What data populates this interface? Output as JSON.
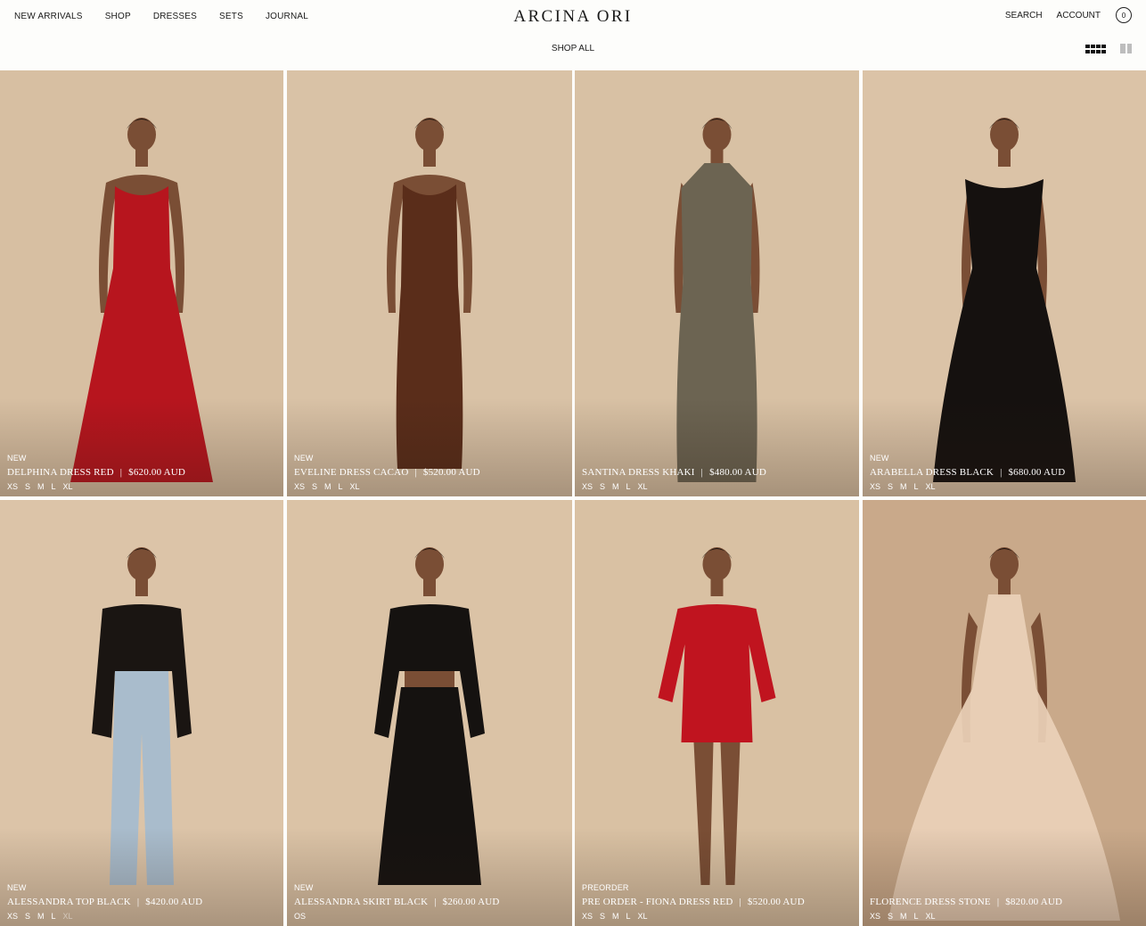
{
  "header": {
    "nav": [
      "NEW ARRIVALS",
      "SHOP",
      "DRESSES",
      "SETS",
      "JOURNAL"
    ],
    "logo": "ARCINA ORI",
    "search": "SEARCH",
    "account": "ACCOUNT",
    "cart_count": "0",
    "subnav": "SHOP ALL"
  },
  "products": [
    {
      "tag": "NEW",
      "name": "DELPHINA DRESS RED",
      "price": "$620.00 AUD",
      "sizes": [
        "XS",
        "S",
        "M",
        "L",
        "XL"
      ],
      "unavailable": [],
      "bg": "#d7bfa2",
      "garment": "#b7151e",
      "style": "gown-tiered"
    },
    {
      "tag": "NEW",
      "name": "EVELINE DRESS CACAO",
      "price": "$520.00 AUD",
      "sizes": [
        "XS",
        "S",
        "M",
        "L",
        "XL"
      ],
      "unavailable": [],
      "bg": "#d9c2a6",
      "garment": "#5a2d1a",
      "style": "gown-slip"
    },
    {
      "tag": "",
      "name": "SANTINA DRESS KHAKI",
      "price": "$480.00 AUD",
      "sizes": [
        "XS",
        "S",
        "M",
        "L",
        "XL"
      ],
      "unavailable": [],
      "bg": "#d8c1a4",
      "garment": "#6c6452",
      "style": "gown-halter"
    },
    {
      "tag": "NEW",
      "name": "ARABELLA DRESS BLACK",
      "price": "$680.00 AUD",
      "sizes": [
        "XS",
        "S",
        "M",
        "L",
        "XL"
      ],
      "unavailable": [],
      "bg": "#dbc3a7",
      "garment": "#15110f",
      "style": "gown-lace"
    },
    {
      "tag": "NEW",
      "name": "ALESSANDRA TOP BLACK",
      "price": "$420.00 AUD",
      "sizes": [
        "XS",
        "S",
        "M",
        "L",
        "XL"
      ],
      "unavailable": [
        "XL"
      ],
      "bg": "#dcc4a8",
      "garment": "#1a1512",
      "style": "top-jeans"
    },
    {
      "tag": "NEW",
      "name": "ALESSANDRA SKIRT BLACK",
      "price": "$260.00 AUD",
      "sizes": [
        "OS"
      ],
      "unavailable": [],
      "bg": "#dbc3a6",
      "garment": "#151210",
      "style": "set-skirt"
    },
    {
      "tag": "PREORDER",
      "name": "PRE ORDER - FIONA DRESS RED",
      "price": "$520.00 AUD",
      "sizes": [
        "XS",
        "S",
        "M",
        "L",
        "XL"
      ],
      "unavailable": [],
      "bg": "#d9c1a3",
      "garment": "#c0141f",
      "style": "mini"
    },
    {
      "tag": "",
      "name": "FLORENCE DRESS STONE",
      "price": "$820.00 AUD",
      "sizes": [
        "XS",
        "S",
        "M",
        "L",
        "XL"
      ],
      "unavailable": [],
      "bg": "#c9a98a",
      "garment": "#ead1b8",
      "style": "gown-flow"
    }
  ]
}
